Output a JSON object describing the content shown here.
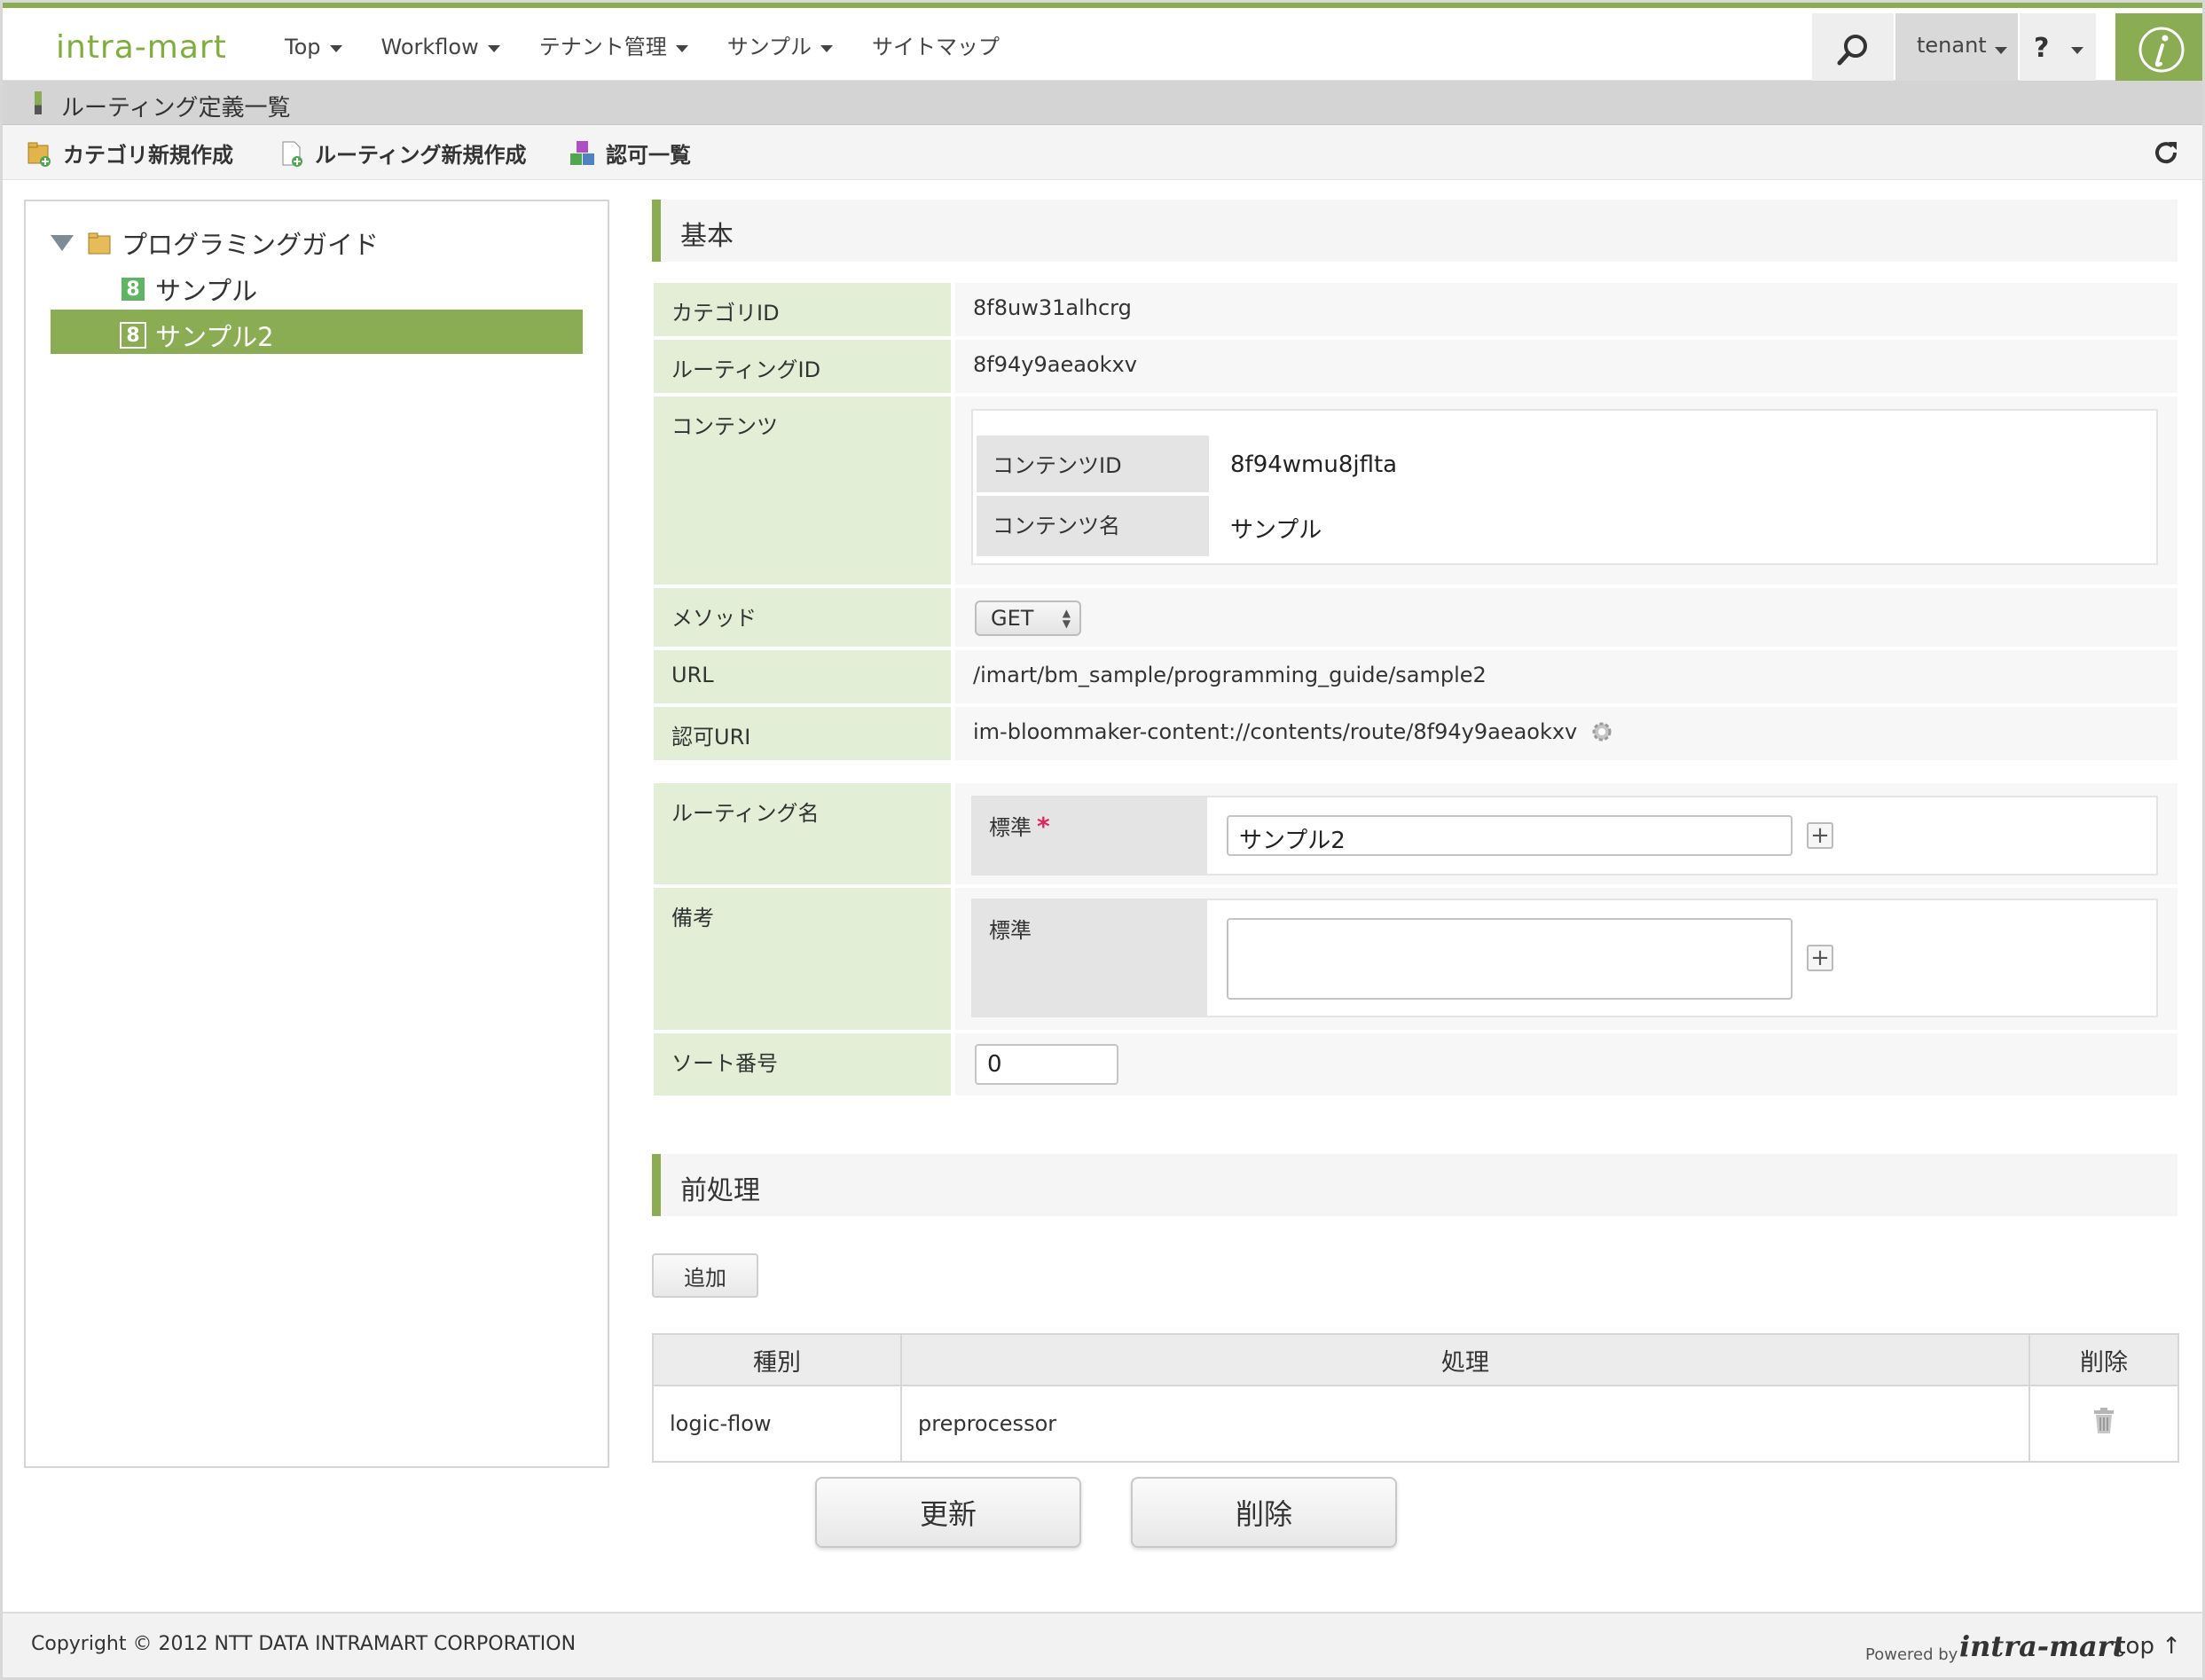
{
  "header": {
    "logo": "intra-mart",
    "nav": [
      "Top",
      "Workflow",
      "テナント管理",
      "サンプル",
      "サイトマップ"
    ],
    "tenant": "tenant",
    "help": "?"
  },
  "titlebar": {
    "title": "ルーティング定義一覧"
  },
  "toolbar": {
    "new_category": "カテゴリ新規作成",
    "new_routing": "ルーティング新規作成",
    "authz_list": "認可一覧"
  },
  "tree": {
    "root": "プログラミングガイド",
    "children": [
      {
        "badge": "8",
        "label": "サンプル"
      },
      {
        "badge": "8",
        "label": "サンプル2"
      }
    ]
  },
  "basic": {
    "section_title": "基本",
    "category_id_label": "カテゴリID",
    "category_id": "8f8uw31alhcrg",
    "routing_id_label": "ルーティングID",
    "routing_id": "8f94y9aeaokxv",
    "content_label": "コンテンツ",
    "content_id_label": "コンテンツID",
    "content_id": "8f94wmu8jflta",
    "content_name_label": "コンテンツ名",
    "content_name": "サンプル",
    "method_label": "メソッド",
    "method": "GET",
    "url_label": "URL",
    "url": "/imart/bm_sample/programming_guide/sample2",
    "authz_uri_label": "認可URI",
    "authz_uri": "im-bloommaker-content://contents/route/8f94y9aeaokxv",
    "routing_name_label": "ルーティング名",
    "locale_standard": "標準",
    "routing_name_value": "サンプル2",
    "note_label": "備考",
    "note_value": "",
    "sort_label": "ソート番号",
    "sort_value": "0"
  },
  "preprocess": {
    "section_title": "前処理",
    "add_label": "追加",
    "columns": [
      "種別",
      "処理",
      "削除"
    ],
    "rows": [
      {
        "type": "logic-flow",
        "process": "preprocessor"
      }
    ]
  },
  "actions": {
    "update": "更新",
    "delete": "削除"
  },
  "footer": {
    "copyright": "Copyright © 2012 NTT DATA INTRAMART CORPORATION",
    "powered_by": "Powered by",
    "brand": "intra-mart",
    "top_link": "top ↑"
  },
  "colors": {
    "accent": "#8aad54",
    "label_bg": "#e3eed6",
    "required": "#e0245e"
  }
}
